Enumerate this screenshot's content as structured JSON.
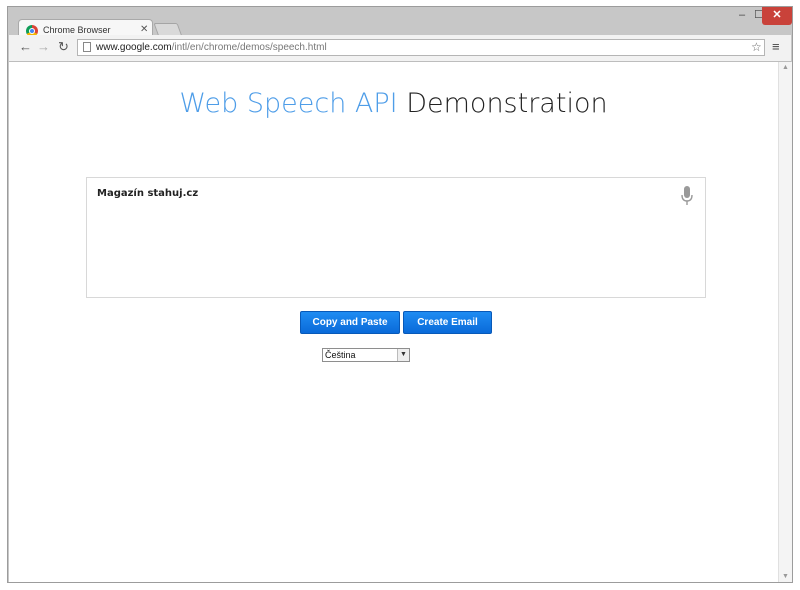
{
  "browser": {
    "tab_title": "Chrome Browser",
    "tab_close": "✕",
    "url_host": "www.google.com",
    "url_path": "/intl/en/chrome/demos/speech.html"
  },
  "window_controls": {
    "minimize": "–",
    "maximize": "☐",
    "close": "✕"
  },
  "page": {
    "title_part1": "Web Speech API",
    "title_part2": "Demonstration",
    "results_text": "Magazín stahuj.cz",
    "copy_button": "Copy and Paste",
    "email_button": "Create Email",
    "language_selected": "Čeština"
  },
  "colors": {
    "title_accent": "#4e9de8",
    "button_blue": "#1f8cf2",
    "close_red": "#c9423a"
  }
}
